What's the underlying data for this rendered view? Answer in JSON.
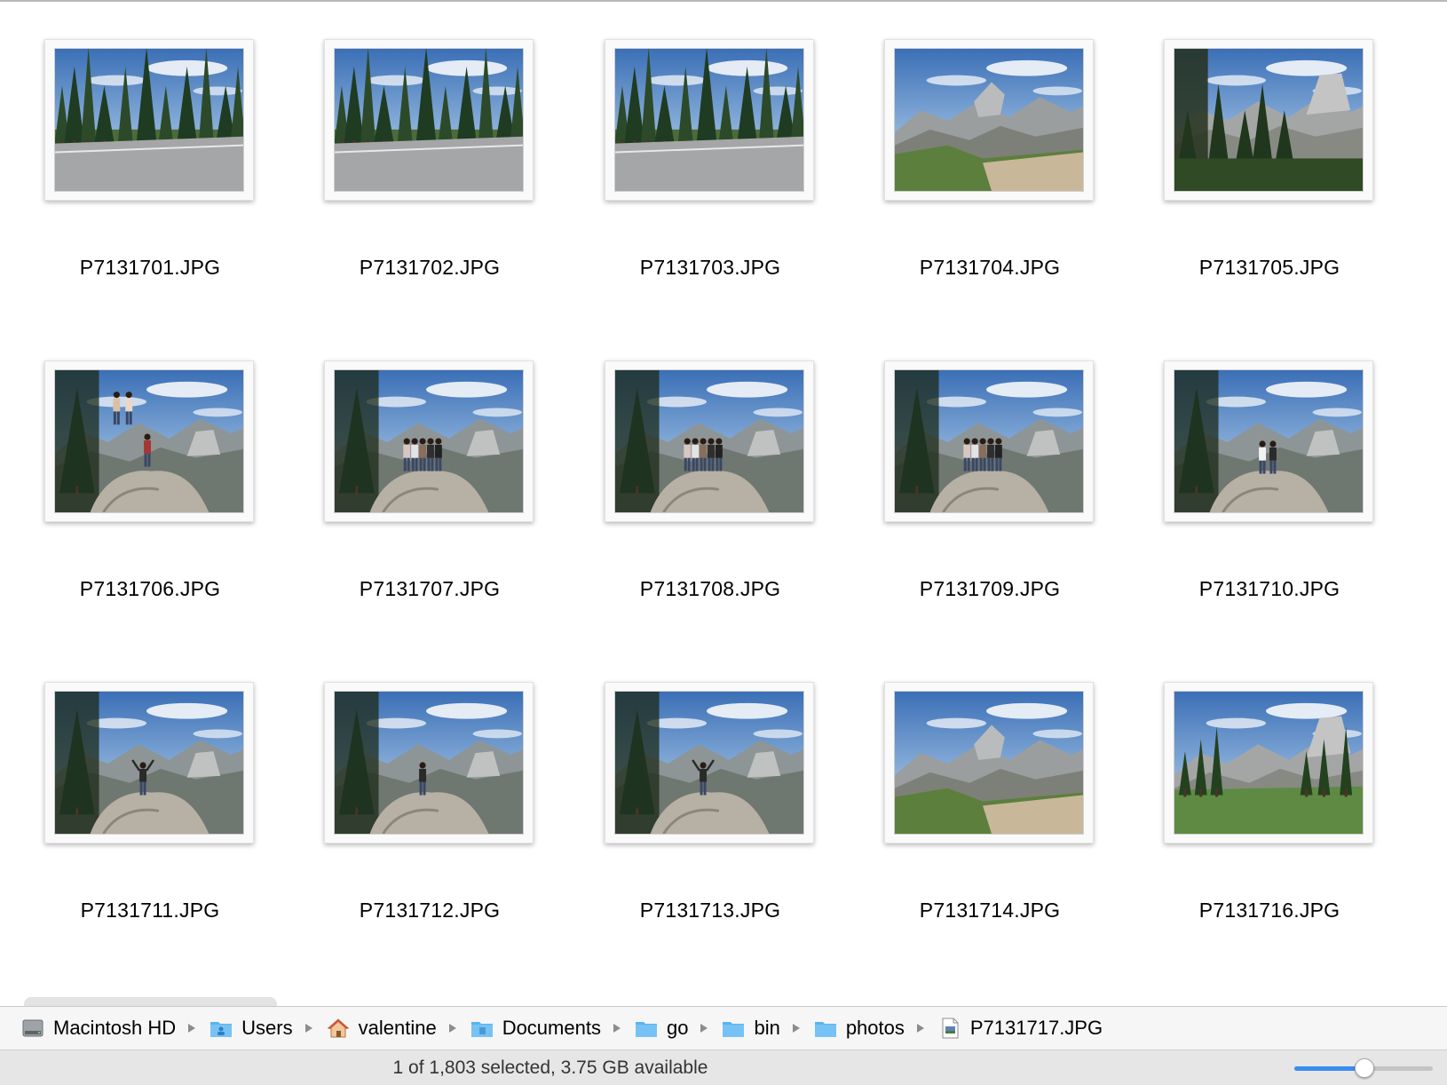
{
  "files": [
    {
      "name": "P7131701.JPG",
      "scene": "road"
    },
    {
      "name": "P7131702.JPG",
      "scene": "road"
    },
    {
      "name": "P7131703.JPG",
      "scene": "road"
    },
    {
      "name": "P7131704.JPG",
      "scene": "valley"
    },
    {
      "name": "P7131705.JPG",
      "scene": "forest-dome"
    },
    {
      "name": "P7131706.JPG",
      "scene": "climb"
    },
    {
      "name": "P7131707.JPG",
      "scene": "group"
    },
    {
      "name": "P7131708.JPG",
      "scene": "group"
    },
    {
      "name": "P7131709.JPG",
      "scene": "group"
    },
    {
      "name": "P7131710.JPG",
      "scene": "pair"
    },
    {
      "name": "P7131711.JPG",
      "scene": "solo"
    },
    {
      "name": "P7131712.JPG",
      "scene": "solo"
    },
    {
      "name": "P7131713.JPG",
      "scene": "solo"
    },
    {
      "name": "P7131714.JPG",
      "scene": "valley"
    },
    {
      "name": "P7131716.JPG",
      "scene": "meadow-dome"
    }
  ],
  "pathbar": {
    "items": [
      {
        "label": "Macintosh HD",
        "icon": "hard-drive-icon"
      },
      {
        "label": "Users",
        "icon": "users-folder-icon"
      },
      {
        "label": "valentine",
        "icon": "home-icon"
      },
      {
        "label": "Documents",
        "icon": "documents-folder-icon"
      },
      {
        "label": "go",
        "icon": "folder-icon"
      },
      {
        "label": "bin",
        "icon": "folder-icon"
      },
      {
        "label": "photos",
        "icon": "folder-icon"
      },
      {
        "label": "P7131717.JPG",
        "icon": "jpeg-file-icon"
      }
    ]
  },
  "status": {
    "text": "1 of 1,803 selected, 3.75 GB available"
  },
  "zoom": {
    "level": 0.5
  },
  "colors": {
    "accent": "#3b8cf0",
    "folder": "#5ab4f0"
  }
}
